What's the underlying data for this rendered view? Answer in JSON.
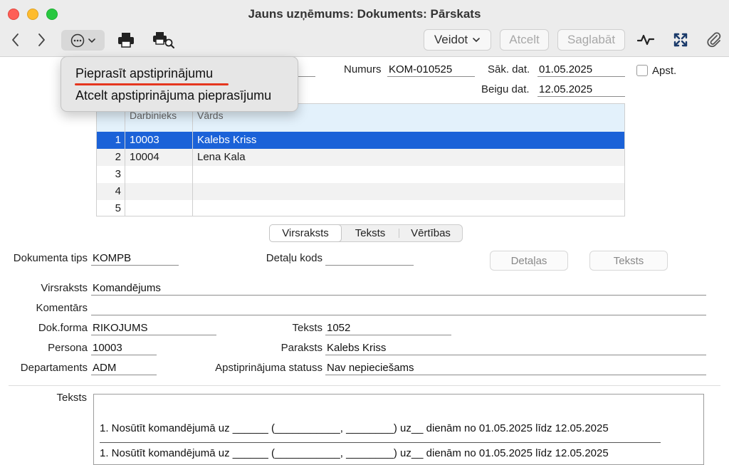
{
  "window": {
    "title": "Jauns uzņēmums: Dokuments: Pārskats"
  },
  "toolbar": {
    "veidot_label": "Veidot",
    "atcelt_label": "Atcelt",
    "saglabat_label": "Saglabāt"
  },
  "menu": {
    "items": [
      {
        "label": "Pieprasīt apstiprinājumu"
      },
      {
        "label": "Atcelt apstiprinājuma pieprasījumu"
      }
    ]
  },
  "header": {
    "numurs_label": "Numurs",
    "numurs_value": "KOM-010525",
    "sak_dat_label": "Sāk. dat.",
    "sak_dat_value": "01.05.2025",
    "beigu_dat_label": "Beigu dat.",
    "beigu_dat_value": "12.05.2025",
    "apst_label": "Apst."
  },
  "grid": {
    "columns": [
      "Darbinieks",
      "Vārds"
    ],
    "rows": [
      {
        "num": "1",
        "darbinieks": "10003",
        "vards": "Kalebs Kriss"
      },
      {
        "num": "2",
        "darbinieks": "10004",
        "vards": "Lena Kala"
      },
      {
        "num": "3",
        "darbinieks": "",
        "vards": ""
      },
      {
        "num": "4",
        "darbinieks": "",
        "vards": ""
      },
      {
        "num": "5",
        "darbinieks": "",
        "vards": ""
      }
    ]
  },
  "tabs": [
    {
      "label": "Virsraksts"
    },
    {
      "label": "Teksts"
    },
    {
      "label": "Vērtības"
    }
  ],
  "form": {
    "dok_tips_label": "Dokumenta tips",
    "dok_tips_value": "KOMPB",
    "detalu_kods_label": "Detaļu kods",
    "detalu_kods_value": "",
    "detalas_button": "Detaļas",
    "teksts_button": "Teksts",
    "virsraksts_label": "Virsraksts",
    "virsraksts_value": "Komandējums",
    "komentars_label": "Komentārs",
    "komentars_value": "",
    "dok_forma_label": "Dok.forma",
    "dok_forma_value": "RIKOJUMS",
    "teksts_label": "Teksts",
    "teksts_value": "1052",
    "persona_label": "Persona",
    "persona_value": "10003",
    "paraksts_label": "Paraksts",
    "paraksts_value": "Kalebs Kriss",
    "departaments_label": "Departaments",
    "departaments_value": "ADM",
    "apst_statuss_label": "Apstiprinājuma statuss",
    "apst_statuss_value": "Nav nepieciešams"
  },
  "text_section": {
    "label": "Teksts",
    "line1": "1. Nosūtīt komandējumā    uz ______ (___________, ________) uz__ dienām no 01.05.2025 līdz  12.05.2025",
    "line2": "1. Nosūtīt komandējumā    uz ______ (___________, ________) uz__ dienām no 01.05.2025 līdz  12.05.2025"
  }
}
